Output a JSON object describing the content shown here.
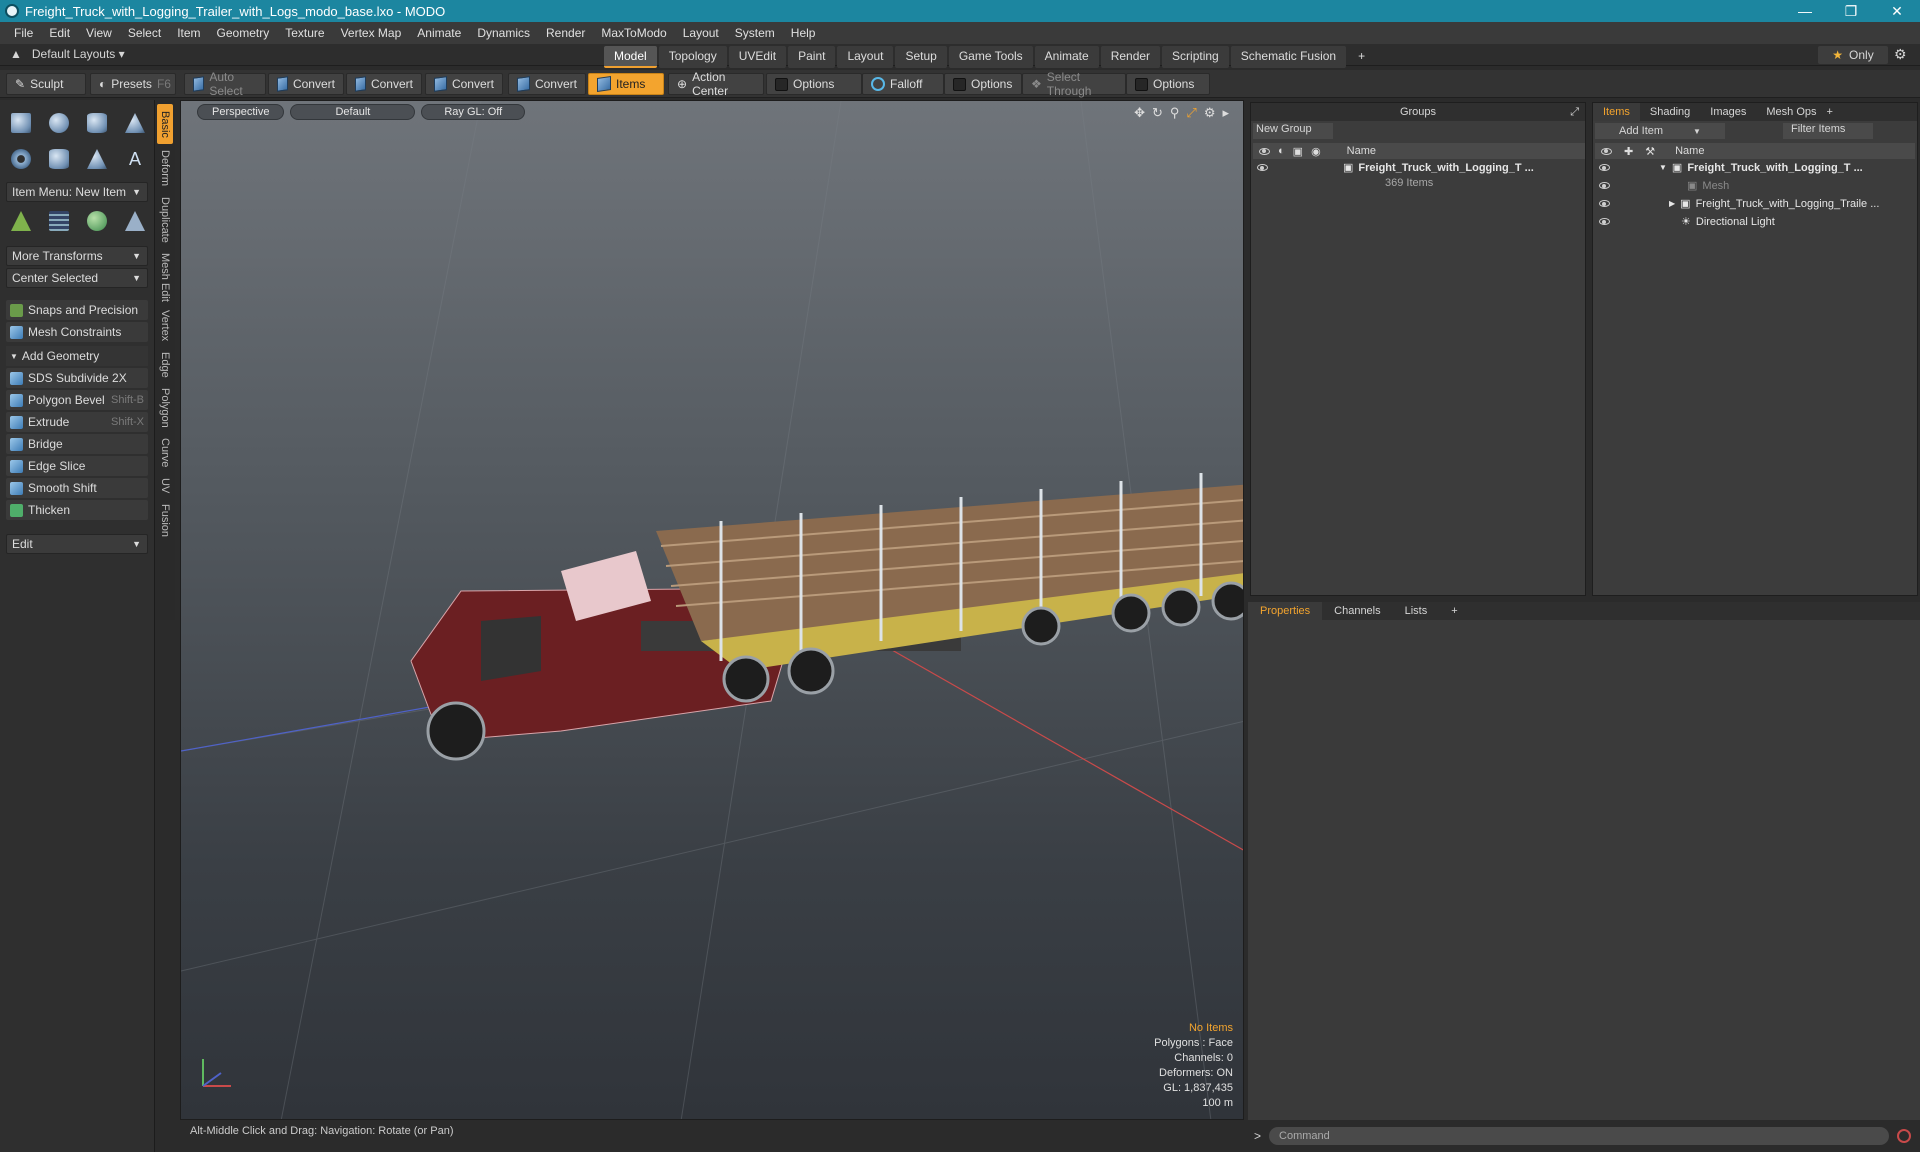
{
  "window": {
    "title": "Freight_Truck_with_Logging_Trailer_with_Logs_modo_base.lxo - MODO"
  },
  "menu": [
    "File",
    "Edit",
    "View",
    "Select",
    "Item",
    "Geometry",
    "Texture",
    "Vertex Map",
    "Animate",
    "Dynamics",
    "Render",
    "MaxToModo",
    "Layout",
    "System",
    "Help"
  ],
  "layoutbar": {
    "layout_label": "Default Layouts",
    "only_label": "Only"
  },
  "mode_tabs": [
    "Model",
    "Topology",
    "UVEdit",
    "Paint",
    "Layout",
    "Setup",
    "Game Tools",
    "Animate",
    "Render",
    "Scripting",
    "Schematic Fusion"
  ],
  "toolbar": {
    "sculpt": "Sculpt",
    "presets": "Presets",
    "presets_key": "F6",
    "auto_select": "Auto Select",
    "convert": "Convert",
    "items": "Items",
    "action_center": "Action Center",
    "options": "Options",
    "falloff": "Falloff",
    "select_through": "Select Through"
  },
  "left_panel": {
    "item_menu": "Item Menu: New Item",
    "more_transforms": "More Transforms",
    "center_selected": "Center Selected",
    "snaps": "Snaps and Precision",
    "mesh_constraints": "Mesh Constraints",
    "add_geometry": "Add Geometry",
    "tools": [
      {
        "label": "SDS Subdivide 2X",
        "shortcut": ""
      },
      {
        "label": "Polygon Bevel",
        "shortcut": "Shift-B"
      },
      {
        "label": "Extrude",
        "shortcut": "Shift-X"
      },
      {
        "label": "Bridge",
        "shortcut": ""
      },
      {
        "label": "Edge Slice",
        "shortcut": ""
      },
      {
        "label": "Smooth Shift",
        "shortcut": ""
      },
      {
        "label": "Thicken",
        "shortcut": ""
      }
    ],
    "edit": "Edit",
    "vertical_tabs": [
      "Basic",
      "Deform",
      "Duplicate",
      "Mesh Edit",
      "Vertex",
      "Edge",
      "Polygon",
      "Curve",
      "UV",
      "Fusion"
    ]
  },
  "viewport": {
    "view": "Perspective",
    "shading": "Default",
    "raygl": "Ray GL: Off",
    "info": {
      "items": "No Items",
      "polygons": "Polygons : Face",
      "channels": "Channels: 0",
      "deformers": "Deformers: ON",
      "gl": "GL: 1,837,435",
      "scale": "100 m"
    },
    "status": "Alt-Middle Click and Drag:   Navigation: Rotate (or Pan)"
  },
  "groups_panel": {
    "title": "Groups",
    "new_group": "New Group",
    "name_col": "Name",
    "group_name": "Freight_Truck_with_Logging_T ...",
    "group_count": "369 Items"
  },
  "items_panel": {
    "tabs": [
      "Items",
      "Shading",
      "Images",
      "Mesh Ops"
    ],
    "add_item": "Add Item",
    "filter": "Filter Items",
    "name_col": "Name",
    "rows": [
      {
        "label": "Freight_Truck_with_Logging_T ..."
      },
      {
        "label": "Mesh"
      },
      {
        "label": "Freight_Truck_with_Logging_Traile ..."
      },
      {
        "label": "Directional Light"
      }
    ]
  },
  "properties": {
    "tabs": [
      "Properties",
      "Channels",
      "Lists"
    ]
  },
  "command": {
    "placeholder": "Command"
  },
  "colors": {
    "accent": "#f3a42e",
    "titlebar": "#1c86a0"
  }
}
